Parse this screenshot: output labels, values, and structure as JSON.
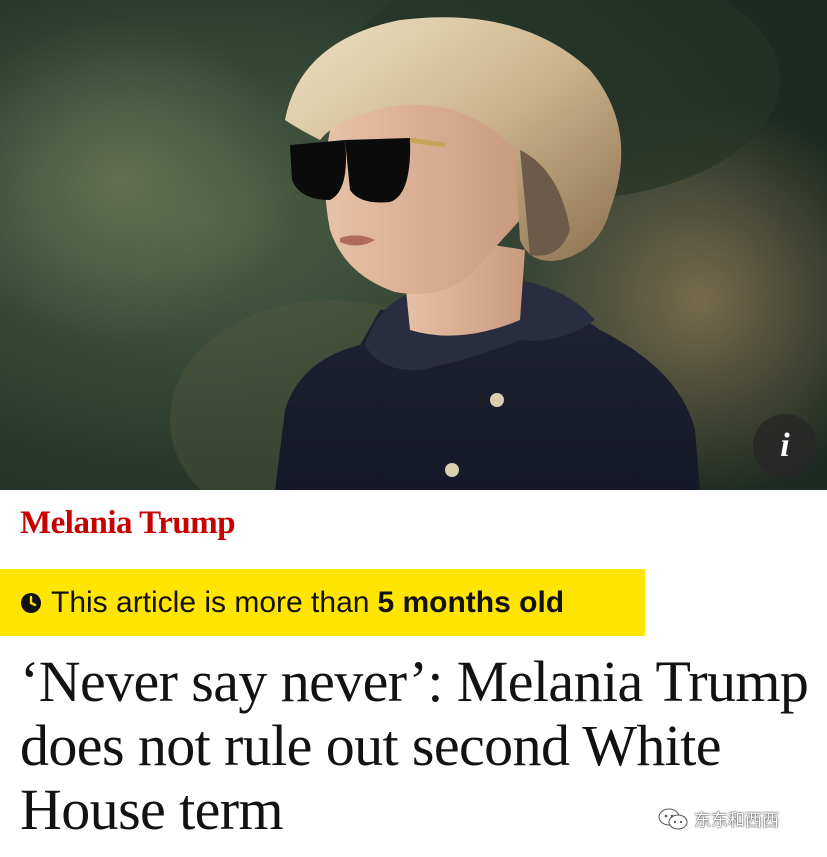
{
  "hero": {
    "info_button_label": "i",
    "info_icon": "info-icon"
  },
  "article": {
    "kicker": "Melania Trump",
    "age_warning": {
      "prefix": "This article is more than",
      "strong": "5 months old",
      "icon": "clock-icon"
    },
    "headline": "‘Never say never’: Melania Trump does not rule out second White House term"
  },
  "watermark": {
    "text": "东东和西西",
    "icon": "wechat-icon"
  },
  "colors": {
    "kicker": "#c70000",
    "age_warning_background": "#ffe500",
    "headline_text": "#121212",
    "info_button_background": "#282828"
  }
}
